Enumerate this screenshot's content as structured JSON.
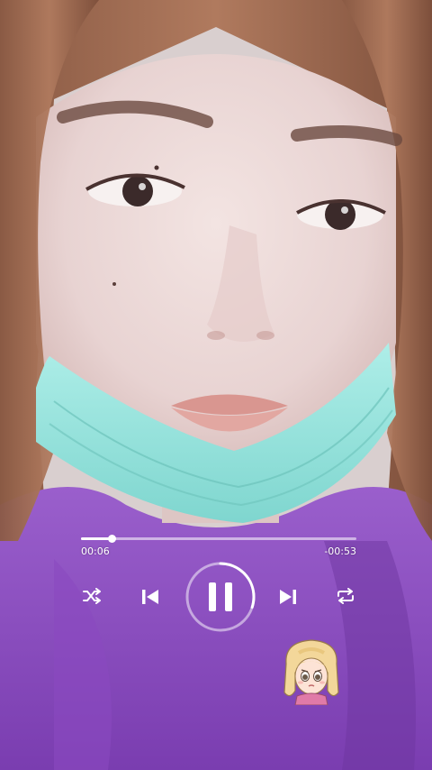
{
  "player": {
    "elapsed": "00:06",
    "remaining": "-00:53",
    "progress": 0.11,
    "ring_progress": 0.3,
    "state": "playing",
    "icons": {
      "shuffle": "shuffle-icon",
      "previous": "skip-previous-icon",
      "play_pause": "pause-icon",
      "next": "skip-next-icon",
      "repeat": "repeat-icon"
    }
  },
  "colors": {
    "controls": "#ffffff",
    "sweater": "#8a4fc0",
    "mask": "#8fe0da"
  }
}
